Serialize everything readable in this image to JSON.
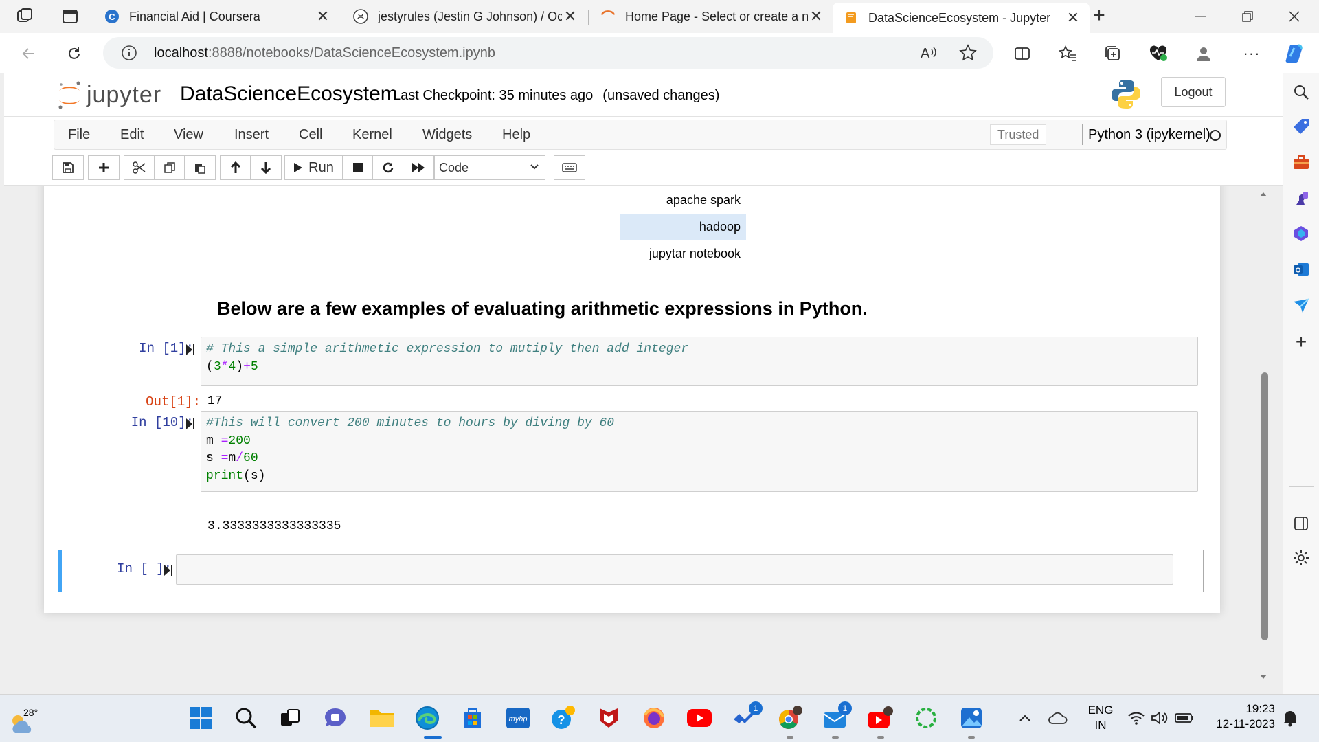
{
  "browser": {
    "tabs": [
      {
        "title": "Financial Aid | Coursera",
        "favicon": "coursera-icon"
      },
      {
        "title": "jestyrules (Jestin G Johnson) / Oc",
        "favicon": "github-icon"
      },
      {
        "title": "Home Page - Select or create a n",
        "favicon": "loading-spinner-icon"
      },
      {
        "title": "DataScienceEcosystem - Jupyter",
        "favicon": "jupyter-notebook-icon",
        "active": true
      }
    ],
    "url_host": "localhost",
    "url_path": ":8888/notebooks/DataScienceEcosystem.ipynb"
  },
  "jupyter": {
    "logo_text": "jupyter",
    "notebook_title": "DataScienceEcosystem",
    "checkpoint": "Last Checkpoint: 35 minutes ago",
    "unsaved": "(unsaved changes)",
    "logout_label": "Logout",
    "menu": [
      "File",
      "Edit",
      "View",
      "Insert",
      "Cell",
      "Kernel",
      "Widgets",
      "Help"
    ],
    "trusted_label": "Trusted",
    "kernel_name": "Python 3 (ipykernel)",
    "run_label": "Run",
    "cell_type": "Code"
  },
  "notebook": {
    "ds_list": [
      "apache spark",
      "hadoop",
      "jupytar notebook"
    ],
    "heading": "Below are a few examples of evaluating arithmetic expressions in Python.",
    "cell1": {
      "prompt": "In [1]:",
      "comment": "# This a simple arithmetic expression to mutiply then add integer",
      "out_prompt": "Out[1]:",
      "output": "17"
    },
    "cell2": {
      "prompt": "In [10]:",
      "comment": "#This will convert 200 minutes to hours by diving by 60",
      "output": "3.3333333333333335"
    },
    "cell3": {
      "prompt": "In [ ]:"
    }
  },
  "taskbar": {
    "temperature": "28°",
    "language_top": "ENG",
    "language_bottom": "IN",
    "time": "19:23",
    "date": "12-11-2023",
    "badges": [
      "1",
      "1"
    ]
  }
}
